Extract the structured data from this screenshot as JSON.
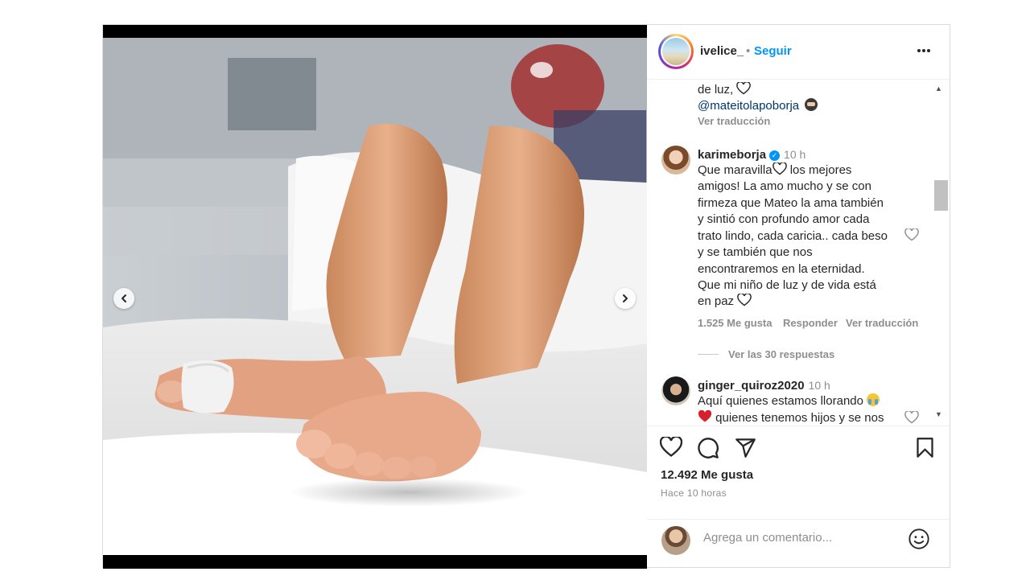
{
  "header": {
    "username": "ivelice_",
    "dot": "•",
    "follow_label": "Seguir",
    "more_icon": "more-horizontal-icon"
  },
  "comments": {
    "partial": {
      "line1": "de luz,",
      "mention": "@mateitolapoborja",
      "translate": "Ver traducción"
    },
    "main": {
      "username": "karimeborja",
      "time": "10 h",
      "lines": [
        "Que maravilla",
        "amigos! La amo mucho y se con",
        "firmeza que Mateo la ama también",
        "y sintió con profundo amor cada",
        "trato lindo, cada caricia.. cada beso",
        "y se también que nos",
        "encontraremos en la eternidad.",
        "Que mi niño de luz y de vida está",
        "en paz"
      ],
      "line1_tail": " los mejores",
      "likes": "1.525 Me gusta",
      "reply": "Responder",
      "translate": "Ver traducción",
      "view_replies": "Ver las 30 respuestas"
    },
    "next": {
      "username": "ginger_quiroz2020",
      "time": "10 h",
      "line1": "Aquí quienes estamos llorando",
      "line2": " quienes tenemos hijos y se nos"
    }
  },
  "actions": {
    "likes": "12.492 Me gusta",
    "time": "Hace 10 horas",
    "comment_placeholder": "Agrega un comentario..."
  },
  "carousel": {
    "slide_count": 21,
    "active_index": 6
  },
  "colors": {
    "link_blue": "#0095f6",
    "mention_blue": "#00376b",
    "text": "#262626",
    "muted": "#8e8e8e"
  }
}
